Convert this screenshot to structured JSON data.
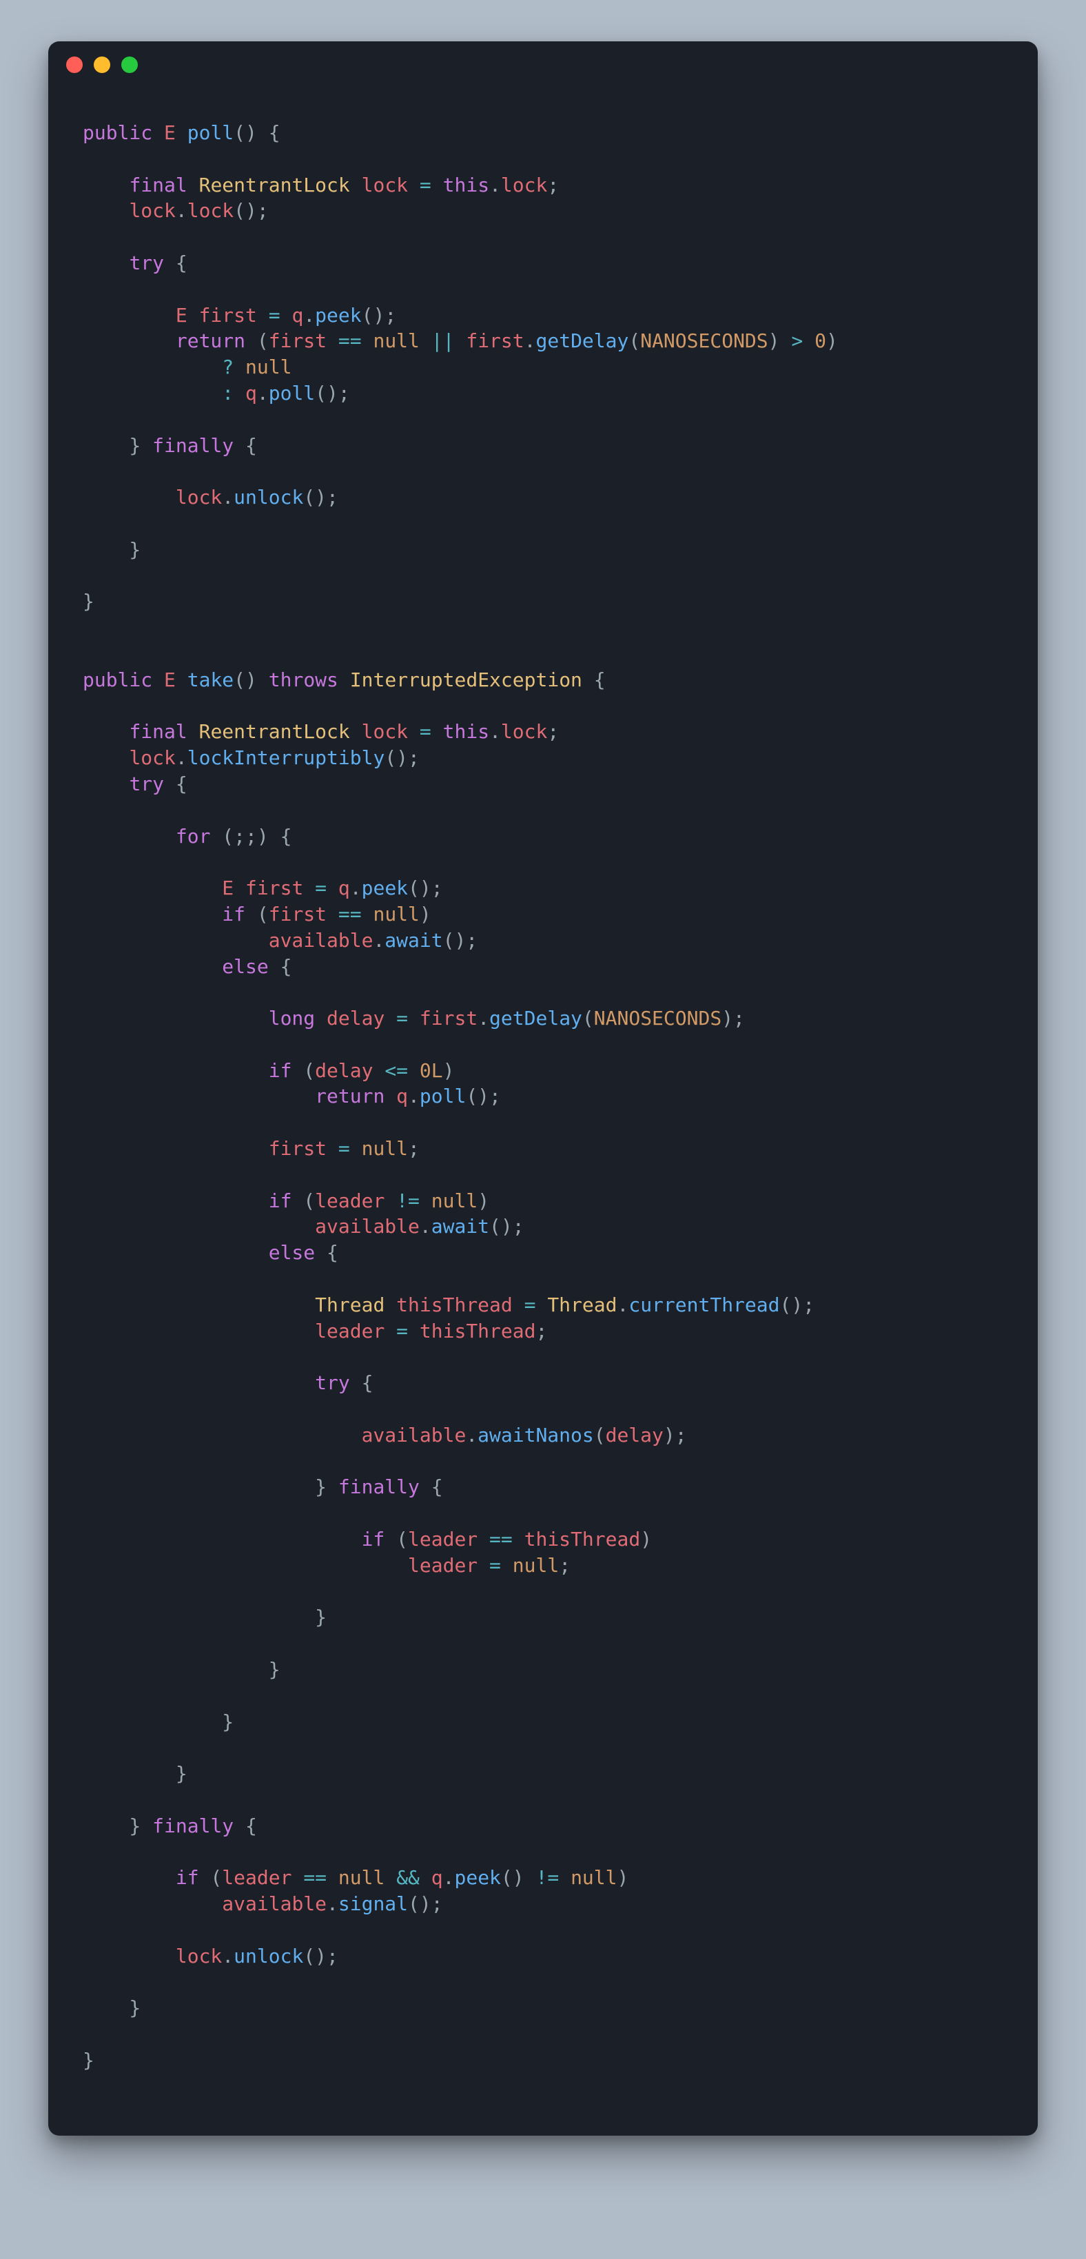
{
  "window": {
    "kind": "code-snippet",
    "traffic_lights": [
      "close",
      "minimize",
      "maximize"
    ]
  },
  "code": {
    "language": "java",
    "methods": [
      {
        "signature": "public E poll()",
        "lines": [
          "public E poll() {",
          "",
          "    final ReentrantLock lock = this.lock;",
          "    lock.lock();",
          "",
          "    try {",
          "",
          "        E first = q.peek();",
          "        return (first == null || first.getDelay(NANOSECONDS) > 0)",
          "            ? null",
          "            : q.poll();",
          "",
          "    } finally {",
          "",
          "        lock.unlock();",
          "",
          "    }",
          "",
          "}"
        ]
      },
      {
        "signature": "public E take() throws InterruptedException",
        "lines": [
          "public E take() throws InterruptedException {",
          "",
          "    final ReentrantLock lock = this.lock;",
          "    lock.lockInterruptibly();",
          "    try {",
          "",
          "        for (;;) {",
          "",
          "            E first = q.peek();",
          "            if (first == null)",
          "                available.await();",
          "            else {",
          "",
          "                long delay = first.getDelay(NANOSECONDS);",
          "",
          "                if (delay <= 0L)",
          "                    return q.poll();",
          "",
          "                first = null;",
          "",
          "                if (leader != null)",
          "                    available.await();",
          "                else {",
          "",
          "                    Thread thisThread = Thread.currentThread();",
          "                    leader = thisThread;",
          "",
          "                    try {",
          "",
          "                        available.awaitNanos(delay);",
          "",
          "                    } finally {",
          "",
          "                        if (leader == thisThread)",
          "                            leader = null;",
          "",
          "                    }",
          "",
          "                }",
          "",
          "            }",
          "",
          "        }",
          "",
          "    } finally {",
          "",
          "        if (leader == null && q.peek() != null)",
          "            available.signal();",
          "",
          "        lock.unlock();",
          "",
          "    }",
          "",
          "}"
        ]
      }
    ]
  }
}
